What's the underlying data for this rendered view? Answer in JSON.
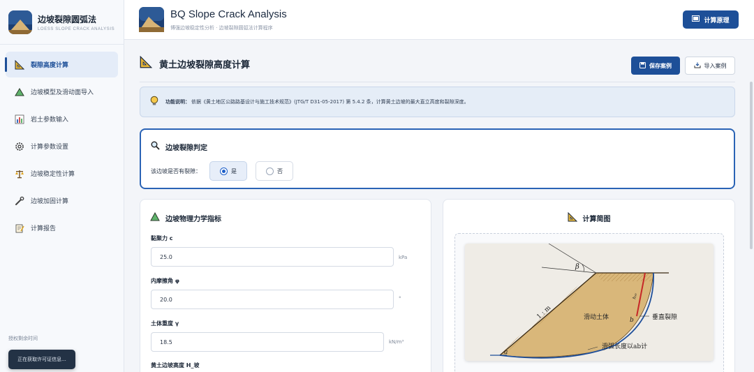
{
  "brand": {
    "title": "边坡裂隙圆弧法",
    "subtitle": "LOESS SLOPE CRACK ANALYSIS"
  },
  "nav": [
    {
      "label": "裂隙高度计算",
      "icon": "set-square-icon",
      "active": true
    },
    {
      "label": "边坡模型及滑动面导入",
      "icon": "triangle-icon",
      "active": false
    },
    {
      "label": "岩土参数输入",
      "icon": "bar-chart-icon",
      "active": false
    },
    {
      "label": "计算参数设置",
      "icon": "gear-icon",
      "active": false
    },
    {
      "label": "边坡稳定性计算",
      "icon": "balance-icon",
      "active": false
    },
    {
      "label": "边坡加固计算",
      "icon": "wrench-icon",
      "active": false
    },
    {
      "label": "计算报告",
      "icon": "report-icon",
      "active": false
    }
  ],
  "license_label": "授权剩余时间",
  "toast_text": "正在获取许可证信息...",
  "app": {
    "title": "BQ Slope Crack Analysis",
    "subtitle": "博强边坡稳定性分析 · 边坡裂隙圆弧法计算程序",
    "principle_button": "计算原理"
  },
  "page": {
    "title": "黄土边坡裂隙高度计算",
    "save_button": "保存案例",
    "import_button": "导入案例",
    "info_label": "功能说明：",
    "info_text": "依据《黄土地区公路路基设计与施工技术规范》(JTG/T D31-05-2017) 第 5.4.2 条，计算黄土边坡的最大直立高度和裂隙深度。"
  },
  "judge": {
    "title": "边坡裂隙判定",
    "question": "该边坡是否有裂隙：",
    "options": [
      "是",
      "否"
    ],
    "selected": "是"
  },
  "params": {
    "title": "边坡物理力学指标",
    "fields": [
      {
        "label": "黏聚力 c",
        "value": "25.0",
        "unit": "kPa"
      },
      {
        "label": "内摩擦角 φ",
        "value": "20.0",
        "unit": "°"
      },
      {
        "label": "土体重度 γ",
        "value": "18.5",
        "unit": "kN/m³"
      },
      {
        "label": "黄土边坡高度 H_坡",
        "value": "",
        "unit": ""
      }
    ]
  },
  "diagram": {
    "title": "计算简图",
    "labels": {
      "beta": "β",
      "ratio": "1 : m",
      "slide_mass": "滑动土体",
      "h": "h₉₀",
      "b": "b",
      "a": "a",
      "crack": "垂直裂隙",
      "arc": "滑弧长度以ab计"
    }
  },
  "colors": {
    "primary": "#1d4f98",
    "accent": "#2a63b5",
    "soil": "#d8b476"
  }
}
